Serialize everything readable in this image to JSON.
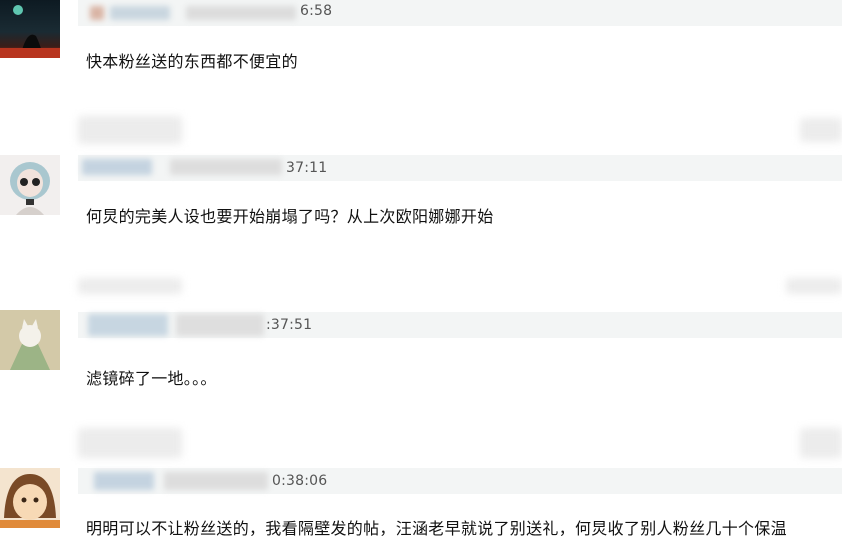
{
  "comments": [
    {
      "time": "6:58",
      "text": "快本粉丝送的东西都不便宜的"
    },
    {
      "time": "37:11",
      "text": "何炅的完美人设也要开始崩塌了吗？从上次欧阳娜娜开始"
    },
    {
      "time": ":37:51",
      "text": "滤镜碎了一地。。。"
    },
    {
      "time": "0:38:06",
      "text": "明明可以不让粉丝送的，我看隔壁发的帖，汪涵老早就说了别送礼，何炅收了别人粉丝几十个保温"
    }
  ]
}
